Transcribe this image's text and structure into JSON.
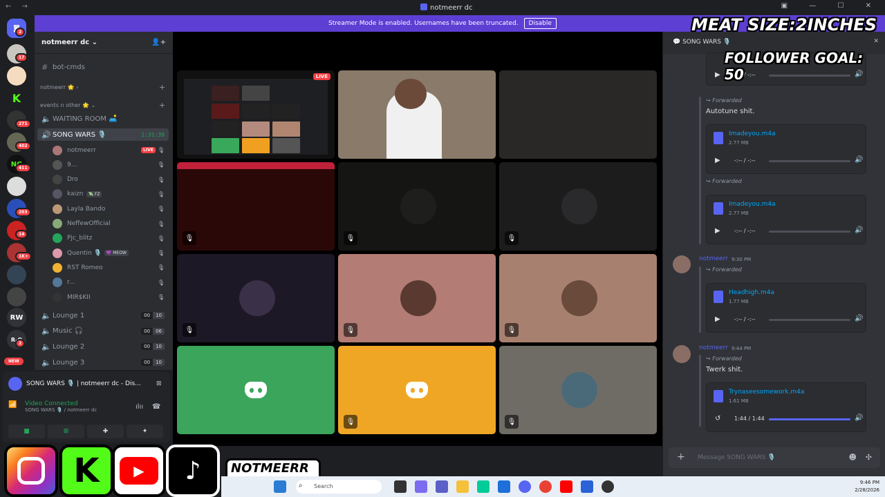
{
  "titlebar": {
    "title": "notmeerr dc",
    "nav": "← →",
    "win_buttons": "▣ — ☐ ✕"
  },
  "banner": {
    "text": "Streamer Mode is enabled. Usernames have been truncated.",
    "disable_label": "Disable"
  },
  "guilds": {
    "badges": [
      "2",
      "17",
      "271",
      "402",
      "411",
      "203",
      "14",
      "1K+",
      "2"
    ],
    "labels": [
      "RW",
      "R-O"
    ],
    "new_label": "NEW"
  },
  "server": {
    "name": "notmeerr dc ⌄",
    "add_member_icon": "add-member-icon"
  },
  "channels": {
    "top": "bot-cmds",
    "cat1": "notmeerr 🌟  ›",
    "cat2": "events n other 🌟  ⌄",
    "waiting": "WAITING ROOM 🛋️",
    "active": "SONG WARS 🎙️",
    "active_timer": "1:31:39",
    "voice_users": [
      {
        "name": "notmeerr",
        "color": "#a77",
        "extra": "LIVE"
      },
      {
        "name": "9...",
        "color": "#555"
      },
      {
        "name": "Dro",
        "color": "#444"
      },
      {
        "name": "kaizn",
        "color": "#556",
        "tag": "💸 FZ"
      },
      {
        "name": "Layla Bando",
        "color": "#b97"
      },
      {
        "name": "NeffewOfficial",
        "color": "#8a7"
      },
      {
        "name": "Pjc_blitz",
        "color": "#23a55a"
      },
      {
        "name": "Quentin 🎙️",
        "color": "#d9a",
        "tag": "💜 MEOW"
      },
      {
        "name": "RST Romeo",
        "color": "#f0b232"
      },
      {
        "name": "r...",
        "color": "#579"
      },
      {
        "name": "MIR$KII",
        "color": "#333"
      }
    ],
    "lounges": [
      {
        "name": "Lounge 1",
        "a": "00",
        "b": "10"
      },
      {
        "name": "Music 🎧",
        "a": "00",
        "b": "06"
      },
      {
        "name": "Lounge 2",
        "a": "00",
        "b": "10"
      },
      {
        "name": "Lounge 3",
        "a": "00",
        "b": "10"
      }
    ]
  },
  "user_panel": {
    "activity": "SONG WARS 🎙️ | notmeerr dc - Dis...",
    "status": "Video Connected",
    "sub": "SONG WARS 🎙️ / notmeerr dc",
    "buttons": [
      "camera-button",
      "screen-share-button",
      "activity-button",
      "soundboard-button"
    ]
  },
  "stage": {
    "live_label": "LIVE"
  },
  "chat": {
    "header": "SONG WARS 🎙️",
    "forwarded": "Forwarded",
    "messages": [
      {
        "text": "Autotune shit.",
        "file": "Imadeyou.m4a",
        "size": "2.77 MB",
        "time": "-:-- / -:--"
      },
      {
        "file": "Imadeyou.m4a",
        "size": "2.77 MB",
        "time": "-:-- / -:--"
      },
      {
        "user": "notmeerr",
        "ts": "9:30 PM",
        "file": "Headhigh.m4a",
        "size": "1.77 MB",
        "time": "-:-- / -:--"
      },
      {
        "user": "notmeerr",
        "ts": "9:44 PM",
        "text": "Twerk shit.",
        "file": "Trynaseesomework.m4a",
        "size": "1.61 MB",
        "time": "1:44 / 1:44"
      }
    ],
    "top_time": "-:-- / -:--",
    "composer_placeholder": "Message SONG WARS 🎙️"
  },
  "overlay": {
    "meat": "MEAT SIZE:2INCHES",
    "goal": "FOLLOWER GOAL: 50",
    "handle": "NOTMEERR"
  },
  "taskbar": {
    "search": "Search",
    "time": "9:46 PM",
    "date": "2/28/2026"
  },
  "colors": {
    "accent": "#5865f2",
    "banner": "#5d3fd3",
    "green": "#23a55a",
    "red": "#f23f43"
  }
}
